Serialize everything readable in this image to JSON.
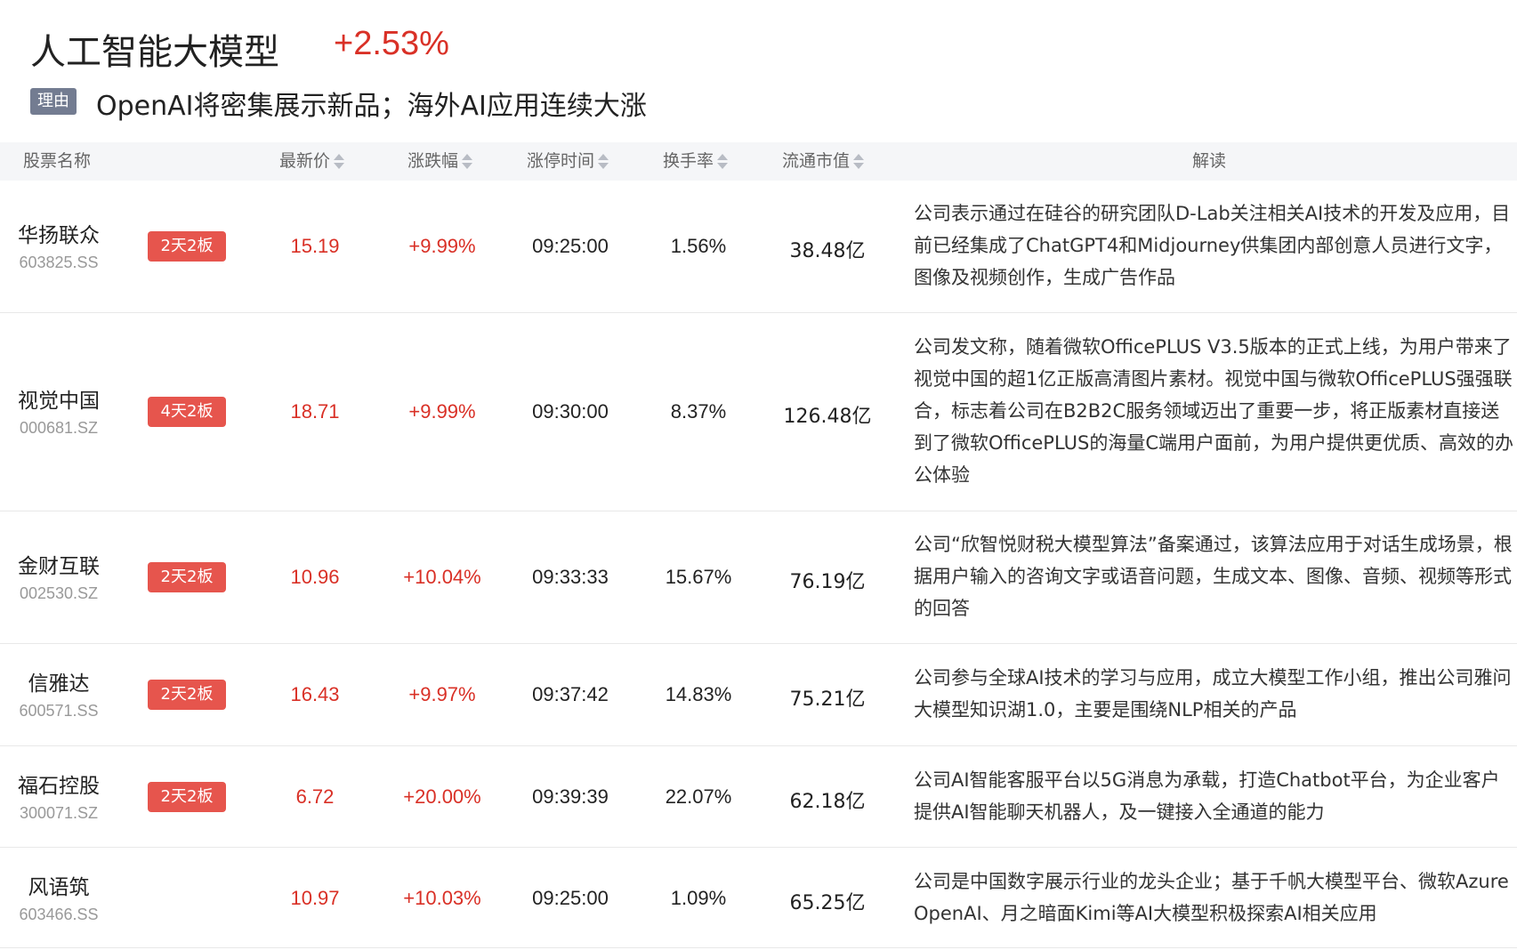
{
  "header": {
    "title": "人工智能大模型",
    "change": "+2.53%",
    "reason_tag": "理由",
    "reason_text": "OpenAI将密集展示新品；海外AI应用连续大涨"
  },
  "columns": {
    "name": "股票名称",
    "price": "最新价",
    "change": "涨跌幅",
    "limit_time": "涨停时间",
    "turnover": "换手率",
    "market_cap": "流通市值",
    "analysis": "解读"
  },
  "rows": [
    {
      "name": "华扬联众",
      "code": "603825.SS",
      "badge": "2天2板",
      "price": "15.19",
      "change": "+9.99%",
      "time": "09:25:00",
      "turnover": "1.56%",
      "market_cap": "38.48亿",
      "desc": "公司表示通过在硅谷的研究团队D-Lab关注相关AI技术的开发及应用，目前已经集成了ChatGPT4和Midjourney供集团内部创意人员进行文字，图像及视频创作，生成广告作品"
    },
    {
      "name": "视觉中国",
      "code": "000681.SZ",
      "badge": "4天2板",
      "price": "18.71",
      "change": "+9.99%",
      "time": "09:30:00",
      "turnover": "8.37%",
      "market_cap": "126.48亿",
      "desc": "公司发文称，随着微软OfficePLUS V3.5版本的正式上线，为用户带来了视觉中国的超1亿正版高清图片素材。视觉中国与微软OfficePLUS强强联合，标志着公司在B2B2C服务领域迈出了重要一步，将正版素材直接送到了微软OfficePLUS的海量C端用户面前，为用户提供更优质、高效的办公体验"
    },
    {
      "name": "金财互联",
      "code": "002530.SZ",
      "badge": "2天2板",
      "price": "10.96",
      "change": "+10.04%",
      "time": "09:33:33",
      "turnover": "15.67%",
      "market_cap": "76.19亿",
      "desc": "公司“欣智悦财税大模型算法”备案通过，该算法应用于对话生成场景，根据用户输入的咨询文字或语音问题，生成文本、图像、音频、视频等形式的回答"
    },
    {
      "name": "信雅达",
      "code": "600571.SS",
      "badge": "2天2板",
      "price": "16.43",
      "change": "+9.97%",
      "time": "09:37:42",
      "turnover": "14.83%",
      "market_cap": "75.21亿",
      "desc": "公司参与全球AI技术的学习与应用，成立大模型工作小组，推出公司雅问大模型知识湖1.0，主要是围绕NLP相关的产品"
    },
    {
      "name": "福石控股",
      "code": "300071.SZ",
      "badge": "2天2板",
      "price": "6.72",
      "change": "+20.00%",
      "time": "09:39:39",
      "turnover": "22.07%",
      "market_cap": "62.18亿",
      "desc": "公司AI智能客服平台以5G消息为承载，打造Chatbot平台，为企业客户提供AI智能聊天机器人，及一键接入全通道的能力"
    },
    {
      "name": "风语筑",
      "code": "603466.SS",
      "badge": "",
      "price": "10.97",
      "change": "+10.03%",
      "time": "09:25:00",
      "turnover": "1.09%",
      "market_cap": "65.25亿",
      "desc": "公司是中国数字展示行业的龙头企业；基于千帆大模型平台、微软Azure OpenAI、月之暗面Kimi等AI大模型积极探索AI相关应用"
    }
  ]
}
